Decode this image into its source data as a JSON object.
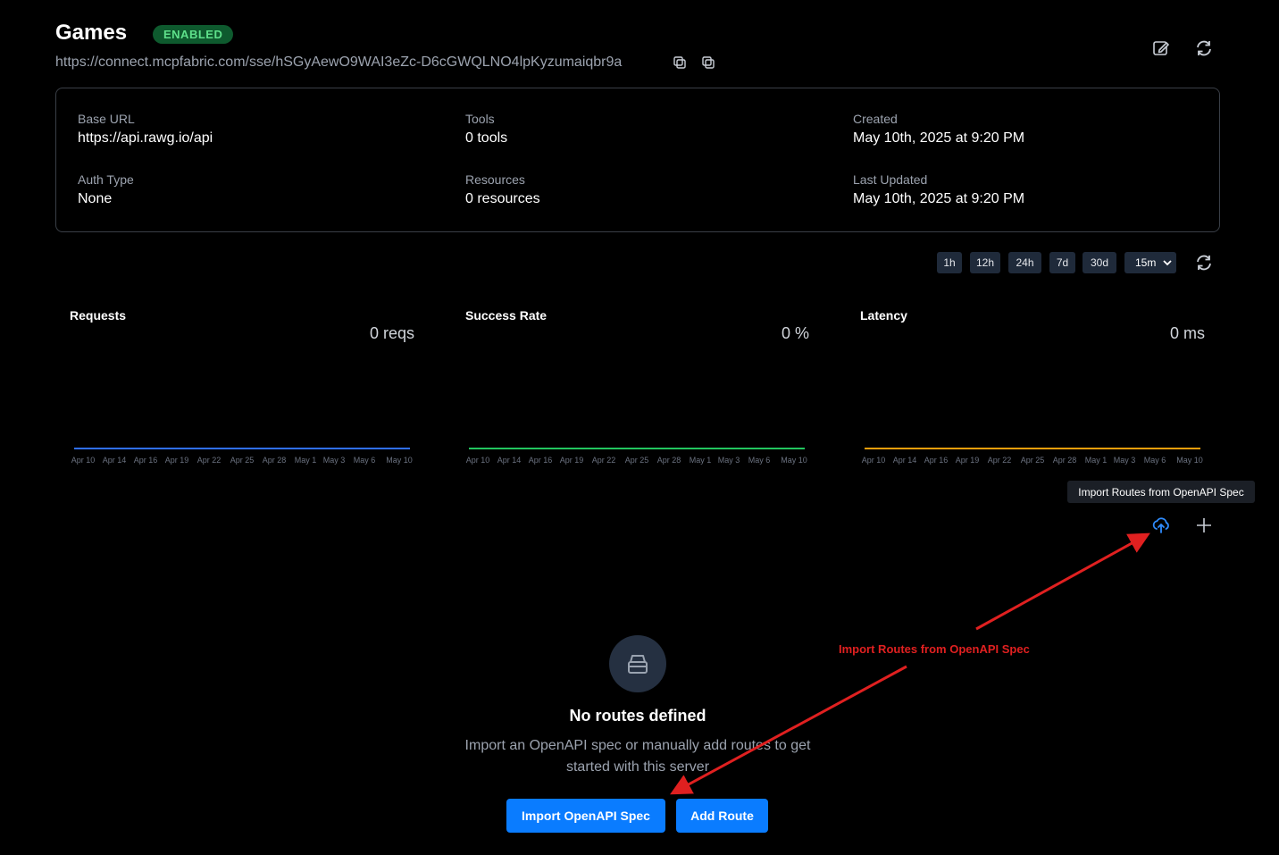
{
  "header": {
    "title": "Games",
    "status_badge": "ENABLED",
    "endpoint_url": "https://connect.mcpfabric.com/sse/hSGyAewO9WAI3eZc-D6cGWQLNO4lpKyzumaiqbr9a",
    "edit_icon": "edit-icon",
    "refresh_icon": "refresh-icon"
  },
  "info": {
    "base_url_label": "Base URL",
    "base_url_value": "https://api.rawg.io/api",
    "tools_label": "Tools",
    "tools_value": "0 tools",
    "created_label": "Created",
    "created_value": "May 10th, 2025 at 9:20 PM",
    "auth_label": "Auth Type",
    "auth_value": "None",
    "resources_label": "Resources",
    "resources_value": "0 resources",
    "updated_label": "Last Updated",
    "updated_value": "May 10th, 2025 at 9:20 PM"
  },
  "controls": {
    "ranges": [
      "1h",
      "12h",
      "24h",
      "7d",
      "30d"
    ],
    "interval_selected": "15m"
  },
  "charts": [
    {
      "title": "Requests",
      "value": "0 reqs",
      "color": "#2f6fff"
    },
    {
      "title": "Success Rate",
      "value": "0 %",
      "color": "#22c55e"
    },
    {
      "title": "Latency",
      "value": "0 ms",
      "color": "#f59e0b"
    }
  ],
  "chart_data": [
    {
      "type": "line",
      "title": "Requests",
      "x": [
        "Apr 10",
        "Apr 14",
        "Apr 16",
        "Apr 19",
        "Apr 22",
        "Apr 25",
        "Apr 28",
        "May 1",
        "May 3",
        "May 6",
        "May 10"
      ],
      "values": [
        0,
        0,
        0,
        0,
        0,
        0,
        0,
        0,
        0,
        0,
        0
      ]
    },
    {
      "type": "line",
      "title": "Success Rate",
      "x": [
        "Apr 10",
        "Apr 14",
        "Apr 16",
        "Apr 19",
        "Apr 22",
        "Apr 25",
        "Apr 28",
        "May 1",
        "May 3",
        "May 6",
        "May 10"
      ],
      "values": [
        0,
        0,
        0,
        0,
        0,
        0,
        0,
        0,
        0,
        0,
        0
      ]
    },
    {
      "type": "line",
      "title": "Latency",
      "x": [
        "Apr 10",
        "Apr 14",
        "Apr 16",
        "Apr 19",
        "Apr 22",
        "Apr 25",
        "Apr 28",
        "May 1",
        "May 3",
        "May 6",
        "May 10"
      ],
      "values": [
        0,
        0,
        0,
        0,
        0,
        0,
        0,
        0,
        0,
        0,
        0
      ]
    }
  ],
  "routes": {
    "tooltip": "Import Routes from OpenAPI Spec",
    "empty_title": "No routes defined",
    "empty_desc": "Import an OpenAPI spec or manually add routes to get started with this server",
    "import_button": "Import OpenAPI Spec",
    "add_button": "Add Route"
  },
  "annotation": {
    "label": "Import Routes from OpenAPI Spec",
    "color": "#e02020"
  }
}
